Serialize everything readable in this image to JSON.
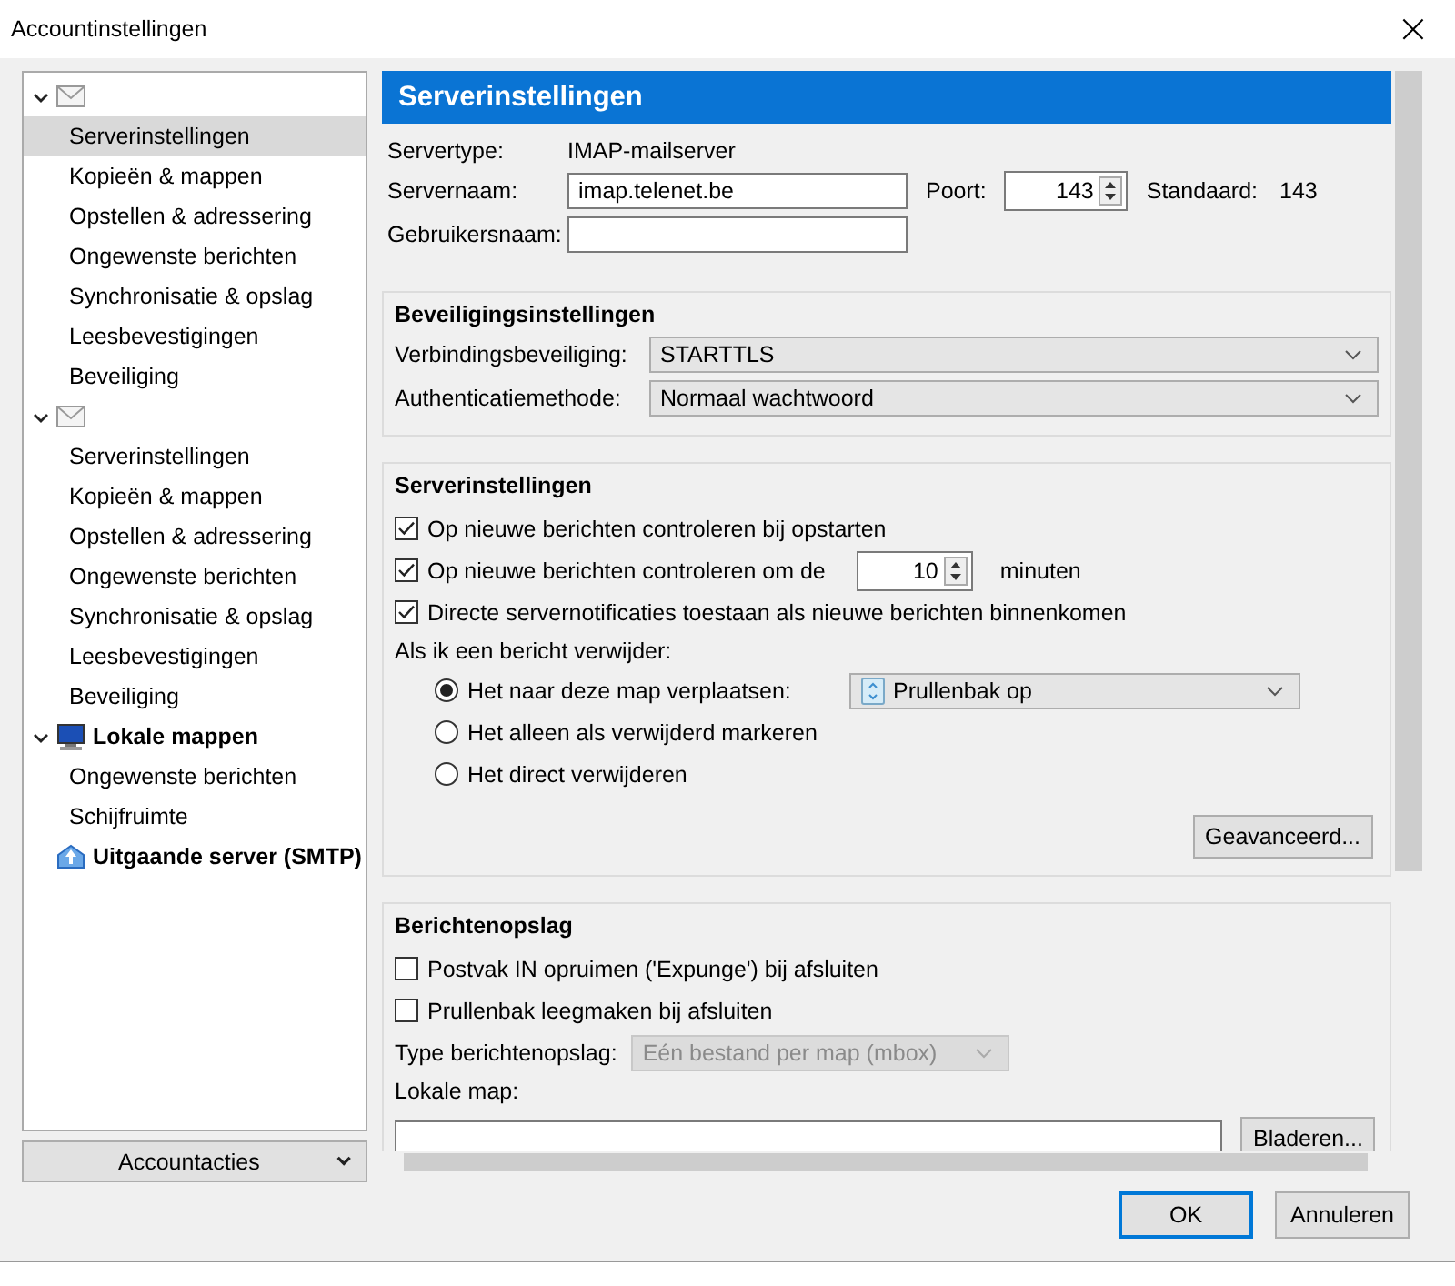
{
  "window": {
    "title": "Accountinstellingen",
    "close": "×"
  },
  "tree": [
    {
      "kind": "mail",
      "expanded": true,
      "children": [
        {
          "label": "Serverinstellingen",
          "selected": true
        },
        {
          "label": "Kopieën & mappen",
          "selected": false
        },
        {
          "label": "Opstellen & adressering",
          "selected": false
        },
        {
          "label": "Ongewenste berichten",
          "selected": false
        },
        {
          "label": "Synchronisatie & opslag",
          "selected": false
        },
        {
          "label": "Leesbevestigingen",
          "selected": false
        },
        {
          "label": "Beveiliging",
          "selected": false
        }
      ]
    },
    {
      "kind": "mail",
      "expanded": true,
      "children": [
        {
          "label": "Serverinstellingen",
          "selected": false
        },
        {
          "label": "Kopieën & mappen",
          "selected": false
        },
        {
          "label": "Opstellen & adressering",
          "selected": false
        },
        {
          "label": "Ongewenste berichten",
          "selected": false
        },
        {
          "label": "Synchronisatie & opslag",
          "selected": false
        },
        {
          "label": "Leesbevestigingen",
          "selected": false
        },
        {
          "label": "Beveiliging",
          "selected": false
        }
      ]
    },
    {
      "kind": "local",
      "label": "Lokale mappen",
      "expanded": true,
      "children": [
        {
          "label": "Ongewenste berichten",
          "selected": false
        },
        {
          "label": "Schijfruimte",
          "selected": false
        }
      ]
    },
    {
      "kind": "smtp",
      "label": "Uitgaande server (SMTP)"
    }
  ],
  "account_actions": {
    "label": "Accountacties"
  },
  "header": {
    "title": "Serverinstellingen"
  },
  "server": {
    "type_label": "Servertype:",
    "type_value": "IMAP-mailserver",
    "name_label": "Servernaam:",
    "name_value": "imap.telenet.be",
    "port_label": "Poort:",
    "port_value": "143",
    "default_label": "Standaard:",
    "default_value": "143",
    "user_label": "Gebruikersnaam:"
  },
  "security": {
    "title": "Beveiligingsinstellingen",
    "rows": [
      {
        "label": "Verbindingsbeveiliging:",
        "value": "STARTTLS"
      },
      {
        "label": "Authenticatiemethode:",
        "value": "Normaal wachtwoord"
      }
    ]
  },
  "server_settings": {
    "title": "Serverinstellingen",
    "checks": [
      {
        "label": "Op nieuwe berichten controleren bij opstarten",
        "checked": true
      },
      {
        "label": "Op nieuwe berichten controleren om de",
        "checked": true,
        "spin": "10",
        "suffix": "minuten"
      },
      {
        "label": "Directe servernotificaties toestaan als nieuwe berichten binnenkomen",
        "checked": true
      }
    ],
    "delete_label": "Als ik een bericht verwijder:",
    "radios": [
      {
        "label": "Het naar deze map verplaatsen:",
        "selected": true,
        "folder": "Prullenbak op"
      },
      {
        "label": "Het alleen als verwijderd markeren",
        "selected": false
      },
      {
        "label": "Het direct verwijderen",
        "selected": false
      }
    ],
    "advanced": "Geavanceerd..."
  },
  "storage": {
    "title": "Berichtenopslag",
    "checks": [
      {
        "label": "Postvak IN opruimen ('Expunge') bij afsluiten",
        "checked": false
      },
      {
        "label": "Prullenbak leegmaken bij afsluiten",
        "checked": false
      }
    ],
    "type_label": "Type berichtenopslag:",
    "type_value": "Eén bestand per map (mbox)",
    "type_disabled": true,
    "local_label": "Lokale map:",
    "browse": "Bladeren..."
  },
  "buttons": [
    {
      "label": "OK",
      "default": true
    },
    {
      "label": "Annuleren",
      "default": false
    }
  ]
}
